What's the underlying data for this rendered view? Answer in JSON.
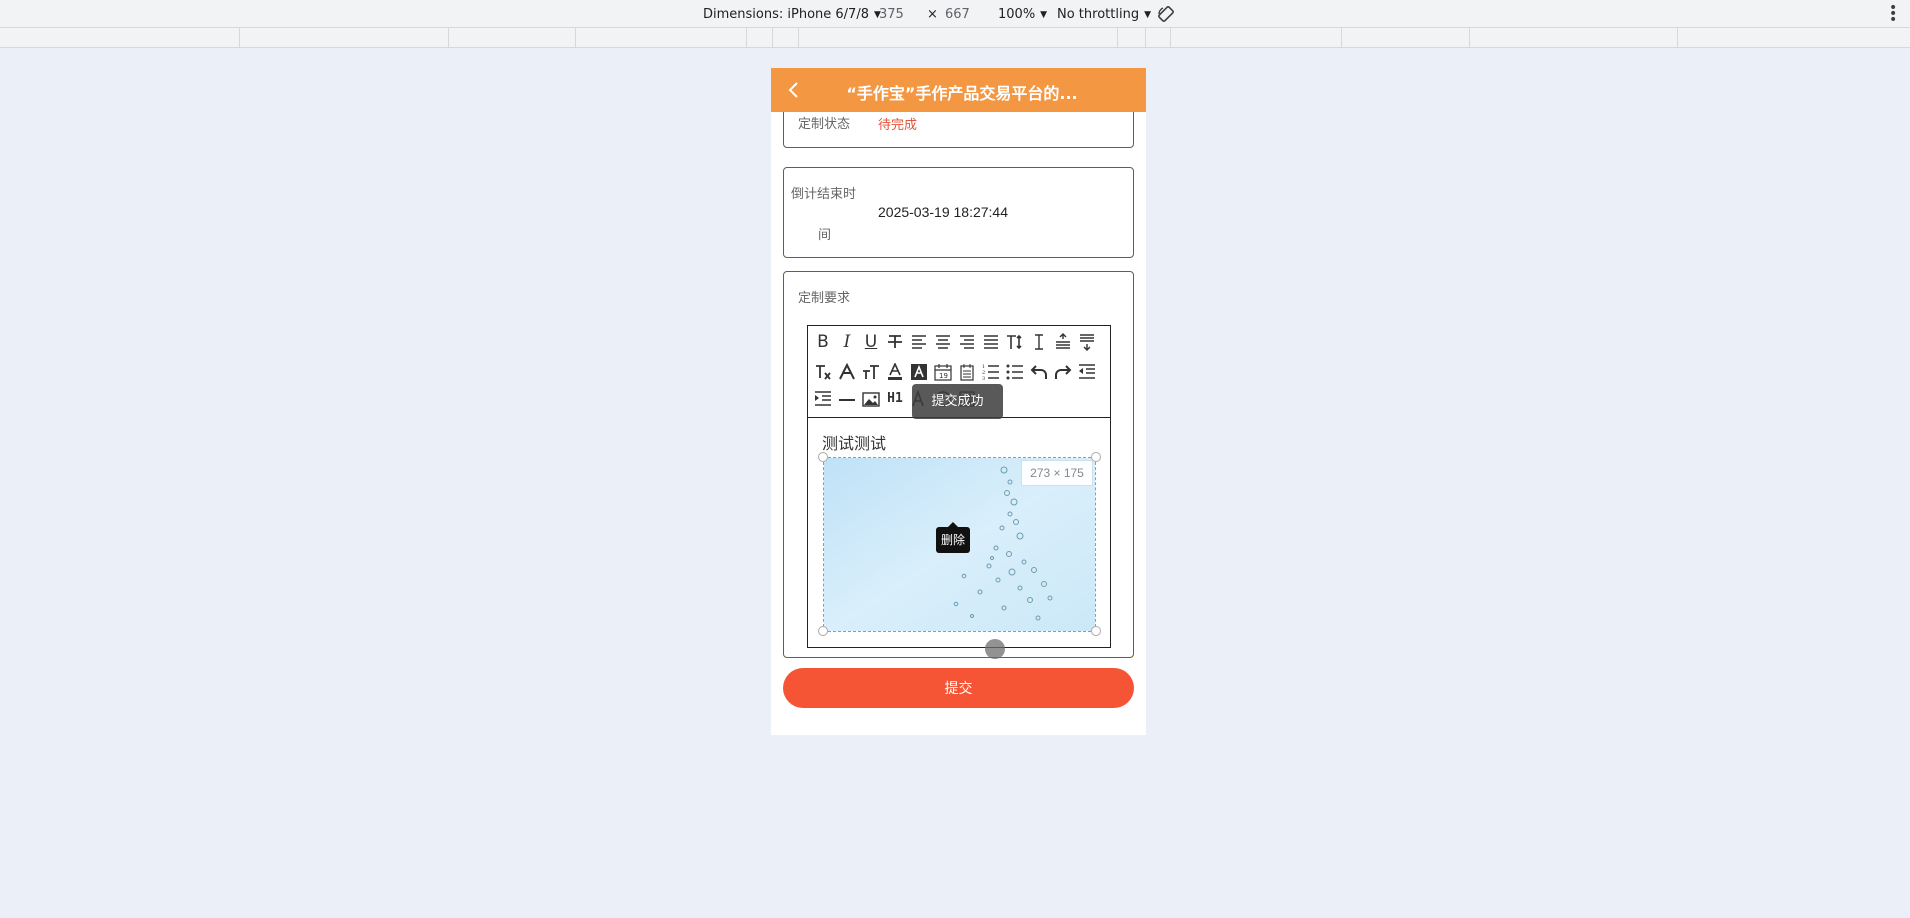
{
  "devtools": {
    "dimensions_label": "Dimensions: iPhone 6/7/8",
    "width": "375",
    "times": "×",
    "height": "667",
    "zoom": "100%",
    "throttling": "No throttling",
    "rotate_icon": "rotate-icon",
    "more_icon": "kebab-menu-icon"
  },
  "header": {
    "title": "“手作宝”手作产品交易平台的...",
    "back_icon": "chevron-left-icon",
    "bg_color": "#f39742"
  },
  "status_card": {
    "label": "定制状态",
    "value": "待完成",
    "value_color": "#e5533c"
  },
  "countdown_card": {
    "label_line1": "倒计结束时",
    "label_line2": "间",
    "value": "2025-03-19 18:27:44"
  },
  "requirement_card": {
    "label": "定制要求",
    "editor": {
      "toolbar_icons": [
        "bold-icon",
        "italic-icon",
        "underline-icon",
        "strikethrough-icon",
        "align-left-icon",
        "align-center-icon",
        "align-right-icon",
        "align-justify-icon",
        "font-size-icon",
        "line-height-icon",
        "paragraph-space-top-icon",
        "paragraph-space-bottom-icon",
        "clear-format-icon",
        "font-family-icon",
        "text-size-icon",
        "font-color-icon",
        "background-color-icon",
        "date-icon",
        "time-icon",
        "ordered-list-icon",
        "unordered-list-icon",
        "undo-icon",
        "redo-icon",
        "outdent-icon",
        "indent-icon",
        "horizontal-rule-icon",
        "image-icon",
        "heading-icon",
        "format-brush-icon",
        "emoji-icon",
        "table-icon"
      ],
      "bold": "B",
      "italic": "I",
      "underline": "U",
      "heading": "H1",
      "content_text": "测试测试",
      "image_size": "273 × 175",
      "delete_tip": "删除"
    }
  },
  "toast": "提交成功",
  "submit_label": "提交",
  "submit_color": "#f55535"
}
